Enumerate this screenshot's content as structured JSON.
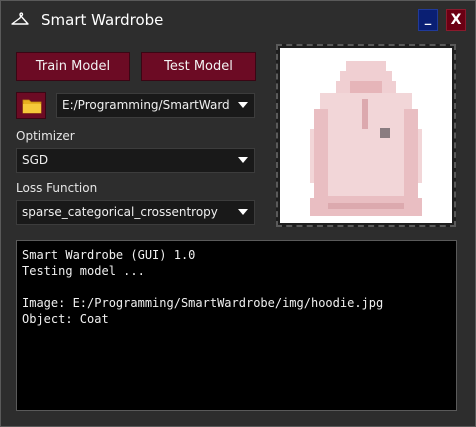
{
  "window": {
    "title": "Smart Wardrobe",
    "minimize_label": "_",
    "close_label": "X"
  },
  "toolbar": {
    "train_label": "Train Model",
    "test_label": "Test Model"
  },
  "path": {
    "value": "E:/Programming/SmartWardrobe/img/hoodie.jpg"
  },
  "optimizer": {
    "label": "Optimizer",
    "selected": "SGD"
  },
  "loss": {
    "label": "Loss Function",
    "selected": "sparse_categorical_crossentropy"
  },
  "preview": {
    "icon": "hoodie-image"
  },
  "console": {
    "lines": [
      "Smart Wardrobe (GUI) 1.0",
      "Testing model ...",
      "",
      "Image: E:/Programming/SmartWardrobe/img/hoodie.jpg",
      "Object: Coat"
    ]
  },
  "colors": {
    "accent": "#6c0b24",
    "minimize": "#0a1f73",
    "close": "#6b0013",
    "background": "#2d2d2d",
    "console_bg": "#000000"
  }
}
